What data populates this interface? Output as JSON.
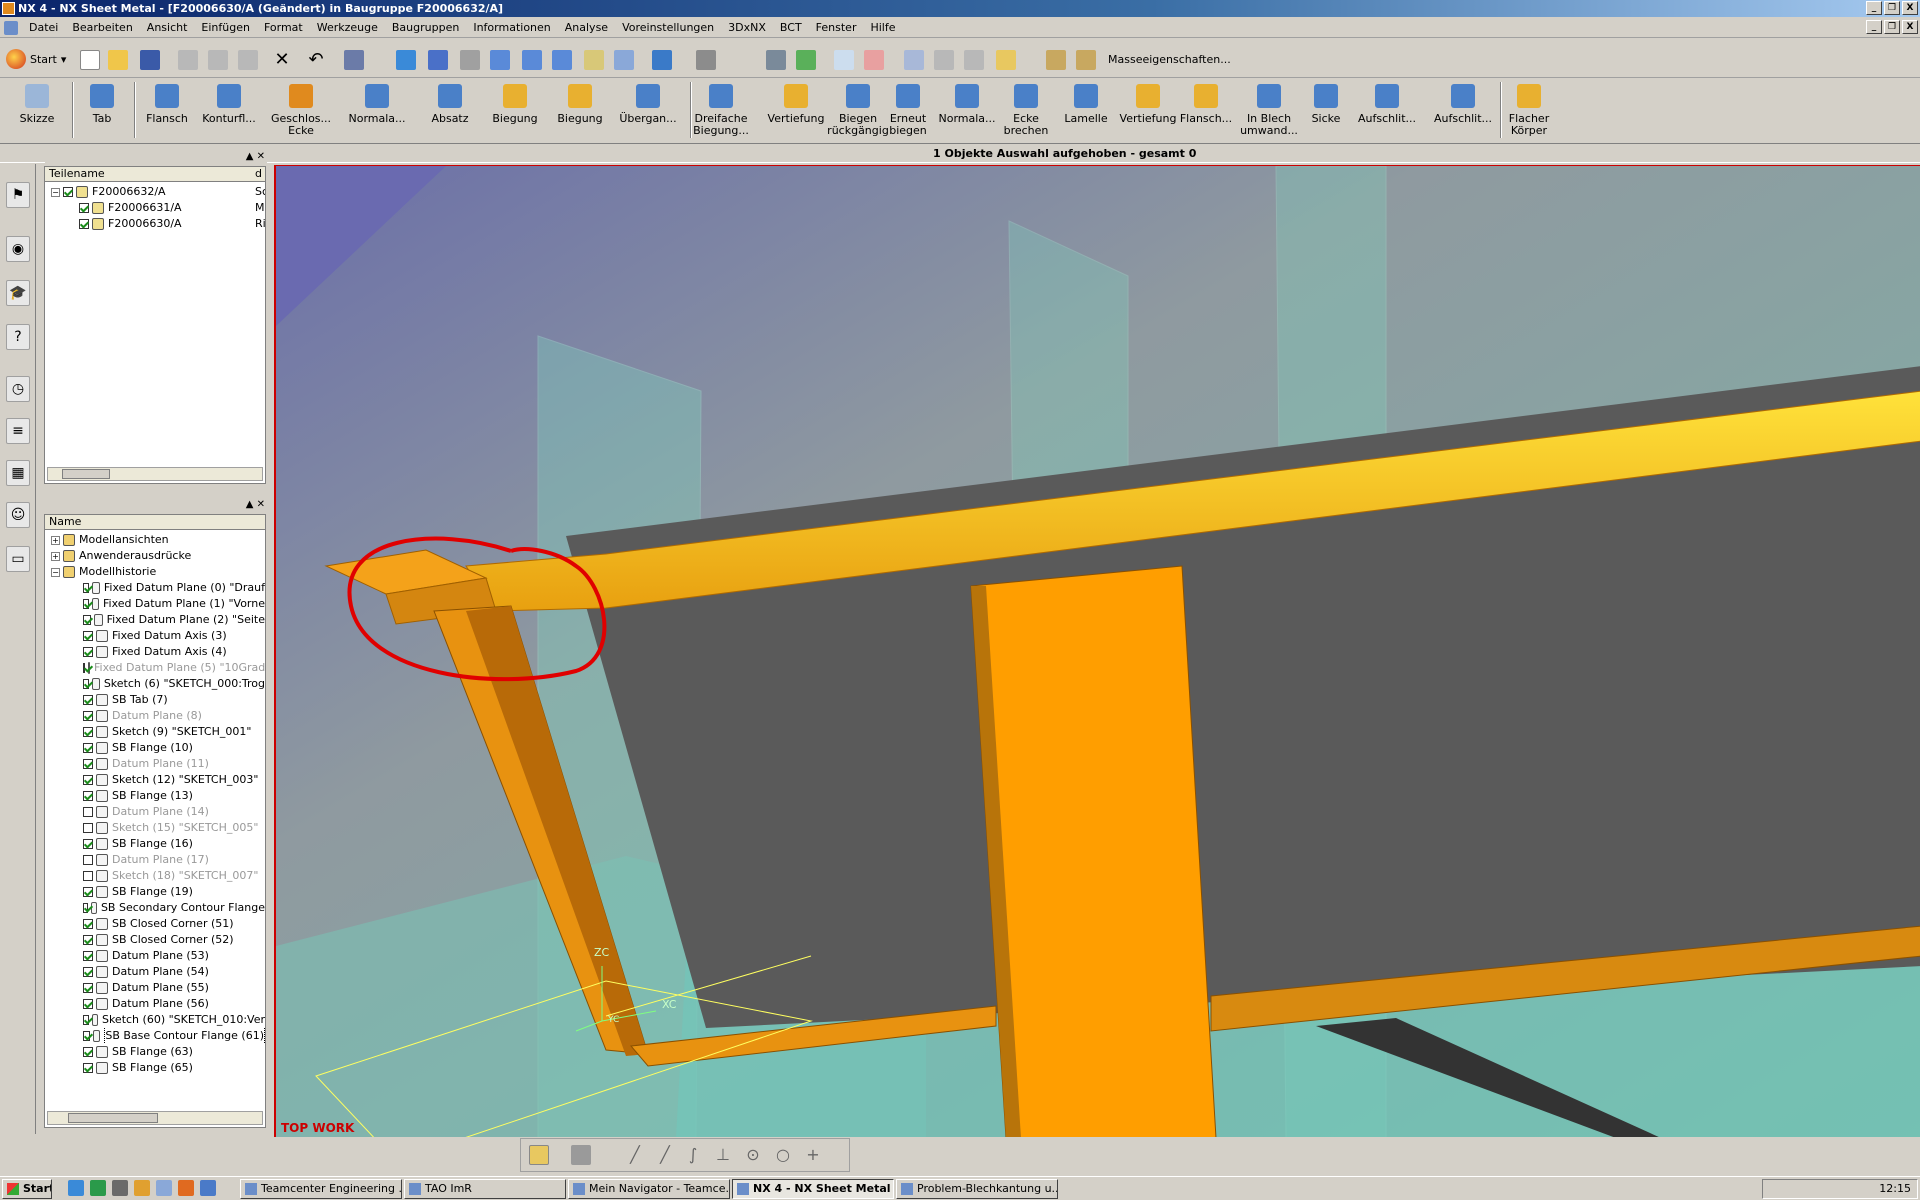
{
  "window": {
    "title": "NX 4 - NX Sheet Metal - [F20006630/A (Geändert)  in Baugruppe F20006632/A]",
    "controls": [
      "_",
      "❐",
      "X"
    ]
  },
  "menu": {
    "items": [
      "Datei",
      "Bearbeiten",
      "Ansicht",
      "Einfügen",
      "Format",
      "Werkzeuge",
      "Baugruppen",
      "Informationen",
      "Analyse",
      "Voreinstellungen",
      "3DxNX",
      "BCT",
      "Fenster",
      "Hilfe"
    ]
  },
  "toolbar": {
    "start_label": "Start",
    "masse_label": "Masseeigenschaften..."
  },
  "ribbon": {
    "buttons": [
      {
        "label": "Skizze",
        "color": "#9bb6d8"
      },
      {
        "label": "Tab",
        "color": "#4a80c8"
      },
      {
        "label": "Flansch",
        "color": "#4a80c8"
      },
      {
        "label": "Konturfl...",
        "color": "#4a80c8"
      },
      {
        "label": "Geschlos... Ecke",
        "color": "#e08a1e"
      },
      {
        "label": "Normala...",
        "color": "#4a80c8"
      },
      {
        "label": "Absatz",
        "color": "#4a80c8"
      },
      {
        "label": "Biegung",
        "color": "#e8b030"
      },
      {
        "label": "Biegung",
        "color": "#e8b030"
      },
      {
        "label": "Übergan...",
        "color": "#4a80c8"
      },
      {
        "label": "Dreifache Biegung...",
        "color": "#4a80c8"
      },
      {
        "label": "Vertiefung",
        "color": "#e8b030"
      },
      {
        "label": "Biegen rückgängig",
        "color": "#4a80c8"
      },
      {
        "label": "Erneut biegen",
        "color": "#4a80c8"
      },
      {
        "label": "Normala...",
        "color": "#4a80c8"
      },
      {
        "label": "Ecke brechen",
        "color": "#4a80c8"
      },
      {
        "label": "Lamelle",
        "color": "#4a80c8"
      },
      {
        "label": "Vertiefung",
        "color": "#e8b030"
      },
      {
        "label": "Flansch...",
        "color": "#e8b030"
      },
      {
        "label": "In Blech umwand...",
        "color": "#4a80c8"
      },
      {
        "label": "Sicke",
        "color": "#4a80c8"
      },
      {
        "label": "Aufschlit...",
        "color": "#4a80c8"
      },
      {
        "label": "Aufschlit...",
        "color": "#4a80c8"
      },
      {
        "label": "Flacher Körper",
        "color": "#e8b030"
      }
    ]
  },
  "status": {
    "message": "1 Objekte Auswahl aufgehoben  - gesamt 0"
  },
  "assembly_navigator": {
    "column1": "Teilename",
    "column2": "d",
    "rows": [
      {
        "name": "F20006632/A",
        "extra": "Sch",
        "indent": 0,
        "expander": "−"
      },
      {
        "name": "F20006631/A",
        "extra": "Mo",
        "indent": 1,
        "expander": ""
      },
      {
        "name": "F20006630/A",
        "extra": "Rin",
        "indent": 1,
        "expander": ""
      }
    ]
  },
  "part_navigator": {
    "column1": "Name",
    "rows": [
      {
        "name": "Modellansichten",
        "type": "folder",
        "expander": "+",
        "check": "none",
        "dim": false
      },
      {
        "name": "Anwenderausdrücke",
        "type": "folder",
        "expander": "+",
        "check": "none",
        "dim": false
      },
      {
        "name": "Modellhistorie",
        "type": "folder",
        "expander": "−",
        "check": "none",
        "dim": false
      },
      {
        "name": "Fixed Datum Plane (0) \"Drauf",
        "check": "on",
        "dim": false
      },
      {
        "name": "Fixed Datum Plane (1) \"Vorne",
        "check": "on",
        "dim": false
      },
      {
        "name": "Fixed Datum Plane (2) \"Seite",
        "check": "on",
        "dim": false
      },
      {
        "name": "Fixed Datum Axis (3)",
        "check": "on",
        "dim": false
      },
      {
        "name": "Fixed Datum Axis (4)",
        "check": "on",
        "dim": false
      },
      {
        "name": "Fixed Datum Plane (5) \"10Grad",
        "check": "on",
        "dim": true
      },
      {
        "name": "Sketch (6) \"SKETCH_000:Trog",
        "check": "on",
        "dim": false
      },
      {
        "name": "SB Tab (7)",
        "check": "on",
        "dim": false
      },
      {
        "name": "Datum Plane (8)",
        "check": "on",
        "dim": true
      },
      {
        "name": "Sketch (9) \"SKETCH_001\"",
        "check": "on",
        "dim": false
      },
      {
        "name": "SB Flange (10)",
        "check": "on",
        "dim": false
      },
      {
        "name": "Datum Plane (11)",
        "check": "on",
        "dim": true
      },
      {
        "name": "Sketch (12) \"SKETCH_003\"",
        "check": "on",
        "dim": false
      },
      {
        "name": "SB Flange (13)",
        "check": "on",
        "dim": false
      },
      {
        "name": "Datum Plane (14)",
        "check": "off",
        "dim": true
      },
      {
        "name": "Sketch (15) \"SKETCH_005\"",
        "check": "off",
        "dim": true
      },
      {
        "name": "SB Flange (16)",
        "check": "on",
        "dim": false
      },
      {
        "name": "Datum Plane (17)",
        "check": "off",
        "dim": true
      },
      {
        "name": "Sketch (18) \"SKETCH_007\"",
        "check": "off",
        "dim": true
      },
      {
        "name": "SB Flange (19)",
        "check": "on",
        "dim": false
      },
      {
        "name": "SB Secondary Contour Flange",
        "check": "on",
        "dim": false
      },
      {
        "name": "SB Closed Corner (51)",
        "check": "on",
        "dim": false
      },
      {
        "name": "SB Closed Corner (52)",
        "check": "on",
        "dim": false
      },
      {
        "name": "Datum Plane (53)",
        "check": "on",
        "dim": false
      },
      {
        "name": "Datum Plane (54)",
        "check": "on",
        "dim": false
      },
      {
        "name": "Datum Plane (55)",
        "check": "on",
        "dim": false
      },
      {
        "name": "Datum Plane (56)",
        "check": "on",
        "dim": false
      },
      {
        "name": "Sketch (60) \"SKETCH_010:Ver",
        "check": "on",
        "dim": false
      },
      {
        "name": "SB Base Contour Flange (61)",
        "check": "on",
        "dim": false,
        "selected": true
      },
      {
        "name": "SB Flange (63)",
        "check": "on",
        "dim": false
      },
      {
        "name": "SB Flange (65)",
        "check": "on",
        "dim": false
      }
    ]
  },
  "viewport": {
    "view_label": "TOP WORK",
    "axis_zc": "ZC",
    "axis_xc": "XC",
    "axis_yc": "YC"
  },
  "taskbar": {
    "start_label": "Start",
    "tasks": [
      {
        "label": "Teamcenter Engineering ...",
        "active": false
      },
      {
        "label": "TAO ImR",
        "active": false
      },
      {
        "label": "Mein Navigator - Teamce...",
        "active": false
      },
      {
        "label": "NX 4 - NX Sheet Metal ...",
        "active": true
      },
      {
        "label": "Problem-Blechkantung u...",
        "active": false
      }
    ],
    "clock": "12:15"
  }
}
